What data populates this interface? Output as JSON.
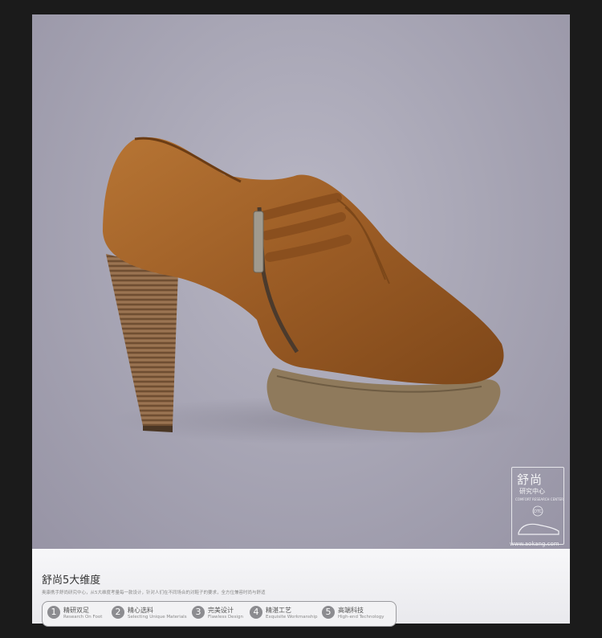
{
  "badge": {
    "title": "舒尚",
    "subtitle": "研究中心",
    "small": "COMFORT RESEARCH CENTER",
    "circle": "DTC"
  },
  "site": "www.aokang.com",
  "info": {
    "title": "舒尚5大维度",
    "description": "奥康携手舒尚研究中心，从5大维度考量每一款设计，针对人们在不同场合的对鞋子的要求，全方位兼容时尚与舒适",
    "features": [
      {
        "num": "1",
        "zh": "精研双足",
        "en": "Research On Foot"
      },
      {
        "num": "2",
        "zh": "精心选料",
        "en": "Selecting Unique Materials"
      },
      {
        "num": "3",
        "zh": "完美设计",
        "en": "Flawless Design"
      },
      {
        "num": "4",
        "zh": "精湛工艺",
        "en": "Exquisite Workmanship"
      },
      {
        "num": "5",
        "zh": "高端科技",
        "en": "High-end Technology"
      }
    ]
  },
  "colors": {
    "background": "#1b1b1b",
    "photo_bg": "#a9a7b6",
    "leather": "#a1612a",
    "heel_wood": "#8a6442",
    "sole": "#8f7a5c"
  }
}
